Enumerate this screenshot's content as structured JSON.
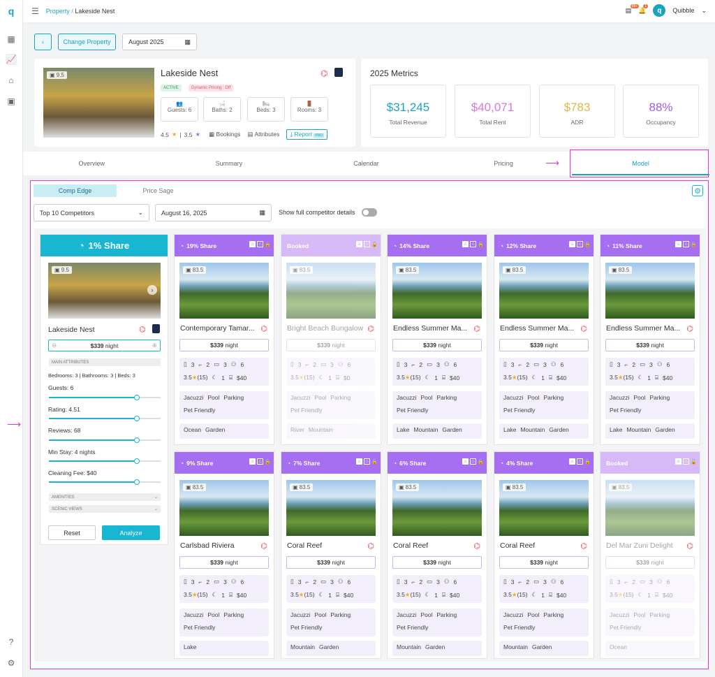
{
  "topbar": {
    "crumb_parent": "Property",
    "crumb_sep": "/",
    "crumb_current": "Lakeside Nest",
    "user": "Quibble",
    "avatar_letter": "q",
    "badge1": "99+",
    "badge2": "1"
  },
  "controls": {
    "change_property": "Change Property",
    "month": "August 2025"
  },
  "property": {
    "name": "Lakeside Nest",
    "photo_score": "9.5",
    "status": "ACTIVE",
    "dynamic_pricing": "Dynamic Pricing : Off",
    "guests": "Guests: 6",
    "baths": "Baths: 2",
    "beds": "Beds: 3",
    "rooms": "Rooms: 3",
    "rating1": "4.5",
    "rating_sep": "|",
    "rating2": "3.5",
    "bookings": "Bookings",
    "attributes": "Attributes",
    "report": "Report",
    "report_tag": "PRO"
  },
  "metrics": {
    "title": "2025 Metrics",
    "items": [
      {
        "value": "$31,245",
        "label": "Total Revenue",
        "color": "#1aa3c0"
      },
      {
        "value": "$40,071",
        "label": "Total Rent",
        "color": "#d978d8"
      },
      {
        "value": "$783",
        "label": "ADR",
        "color": "#e0b84a"
      },
      {
        "value": "88%",
        "label": "Occupancy",
        "color": "#9b5de5"
      }
    ]
  },
  "tabs": [
    "Overview",
    "Summary",
    "Calendar",
    "Pricing",
    "Model"
  ],
  "subtabs": [
    "Comp Edge",
    "Price Sage"
  ],
  "filters": {
    "competitors": "Top 10 Competitors",
    "date": "August 16, 2025",
    "toggle_label": "Show full competitor details"
  },
  "left_panel": {
    "share": "1% Share",
    "name": "Lakeside Nest",
    "score": "9.5",
    "price": "$339",
    "price_unit": "night",
    "main_attr": "MAIN ATTRIBUTES",
    "attr_line": "Bedrooms: 3 | Bathrooms: 3 | Beds: 3",
    "sliders": [
      {
        "label": "Guests: 6",
        "value": 0.79
      },
      {
        "label": "Rating: 4.51",
        "value": 0.79
      },
      {
        "label": "Reviews: 68",
        "value": 0.79
      },
      {
        "label": "Min Stay: 4 nights",
        "value": 0.79
      },
      {
        "label": "Cleaning Fee: $40",
        "value": 0.79
      }
    ],
    "amenities": "AMENITIES",
    "scenic": "SCENIC VIEWS",
    "reset": "Reset",
    "analyze": "Analyze"
  },
  "comps": [
    {
      "share": "19% Share",
      "name": "Contemporary Tamar...",
      "score": "83.5",
      "price": "$339",
      "unit": "night",
      "beds": "3",
      "baths": "2",
      "cars": "3",
      "guests": "6",
      "rating": "3.5",
      "reviews": "(15)",
      "minstay": "1",
      "fee": "$40",
      "tags": [
        "Jacuzzi",
        "Pool",
        "Parking",
        "Pet Friendly"
      ],
      "views": [
        "Ocean",
        "Garden"
      ],
      "booked": false
    },
    {
      "share": "Booked",
      "name": "Bright Beach Bungalow",
      "score": "83.5",
      "price": "$339",
      "unit": "night",
      "beds": "3",
      "baths": "2",
      "cars": "3",
      "guests": "6",
      "rating": "3.5",
      "reviews": "(15)",
      "minstay": "1",
      "fee": "$0",
      "tags": [
        "Jacuzzi",
        "Pool",
        "Parking",
        "Pet Friendly"
      ],
      "views": [
        "River",
        "Mountain"
      ],
      "booked": true
    },
    {
      "share": "14% Share",
      "name": "Endless Summer Ma...",
      "score": "83.5",
      "price": "$339",
      "unit": "night",
      "beds": "3",
      "baths": "2",
      "cars": "3",
      "guests": "6",
      "rating": "3.5",
      "reviews": "(15)",
      "minstay": "1",
      "fee": "$40",
      "tags": [
        "Jacuzzi",
        "Pool",
        "Parking",
        "Pet Friendly"
      ],
      "views": [
        "Lake",
        "Mountain",
        "Garden"
      ],
      "booked": false
    },
    {
      "share": "12% Share",
      "name": "Endless Summer Ma...",
      "score": "83.5",
      "price": "$339",
      "unit": "night",
      "beds": "3",
      "baths": "2",
      "cars": "3",
      "guests": "6",
      "rating": "3.5",
      "reviews": "(15)",
      "minstay": "1",
      "fee": "$40",
      "tags": [
        "Jacuzzi",
        "Pool",
        "Parking",
        "Pet Friendly"
      ],
      "views": [
        "Lake",
        "Mountain",
        "Garden"
      ],
      "booked": false
    },
    {
      "share": "11% Share",
      "name": "Endless Summer Ma...",
      "score": "83.5",
      "price": "$339",
      "unit": "night",
      "beds": "3",
      "baths": "2",
      "cars": "3",
      "guests": "6",
      "rating": "3.5",
      "reviews": "(15)",
      "minstay": "1",
      "fee": "$40",
      "tags": [
        "Jacuzzi",
        "Pool",
        "Parking",
        "Pet Friendly"
      ],
      "views": [
        "Lake",
        "Mountain",
        "Garden"
      ],
      "booked": false
    },
    {
      "share": "9% Share",
      "name": "Carlsbad Riviera",
      "score": "83.5",
      "price": "$339",
      "unit": "night",
      "beds": "3",
      "baths": "2",
      "cars": "3",
      "guests": "6",
      "rating": "3.5",
      "reviews": "(15)",
      "minstay": "1",
      "fee": "$40",
      "tags": [
        "Jacuzzi",
        "Pool",
        "Parking",
        "Pet Friendly"
      ],
      "views": [
        "Lake"
      ],
      "booked": false
    },
    {
      "share": "7% Share",
      "name": "Coral Reef",
      "score": "83.5",
      "price": "$339",
      "unit": "night",
      "beds": "3",
      "baths": "2",
      "cars": "3",
      "guests": "6",
      "rating": "3.5",
      "reviews": "(15)",
      "minstay": "1",
      "fee": "$40",
      "tags": [
        "Jacuzzi",
        "Pool",
        "Parking",
        "Pet Friendly"
      ],
      "views": [
        "Mountain",
        "Garden"
      ],
      "booked": false
    },
    {
      "share": "6% Share",
      "name": "Coral Reef",
      "score": "83.5",
      "price": "$339",
      "unit": "night",
      "beds": "3",
      "baths": "2",
      "cars": "3",
      "guests": "6",
      "rating": "3.5",
      "reviews": "(15)",
      "minstay": "1",
      "fee": "$40",
      "tags": [
        "Jacuzzi",
        "Pool",
        "Parking",
        "Pet Friendly"
      ],
      "views": [
        "Mountain",
        "Garden"
      ],
      "booked": false
    },
    {
      "share": "4% Share",
      "name": "Coral Reef",
      "score": "83.5",
      "price": "$339",
      "unit": "night",
      "beds": "3",
      "baths": "2",
      "cars": "3",
      "guests": "6",
      "rating": "3.5",
      "reviews": "(15)",
      "minstay": "1",
      "fee": "$40",
      "tags": [
        "Jacuzzi",
        "Pool",
        "Parking",
        "Pet Friendly"
      ],
      "views": [
        "Mountain",
        "Garden"
      ],
      "booked": false
    },
    {
      "share": "Booked",
      "name": "Del Mar Zuni Delight",
      "score": "83.5",
      "price": "$339",
      "unit": "night",
      "beds": "3",
      "baths": "2",
      "cars": "3",
      "guests": "6",
      "rating": "3.5",
      "reviews": "(15)",
      "minstay": "1",
      "fee": "$40",
      "tags": [
        "Jacuzzi",
        "Pool",
        "Parking",
        "Pet Friendly"
      ],
      "views": [
        "Ocean"
      ],
      "booked": true
    }
  ],
  "colors": {
    "accent": "#19b6d2",
    "purple": "#a66ef0",
    "booked": "#d6b9f6",
    "highlight": "#e036d1"
  }
}
